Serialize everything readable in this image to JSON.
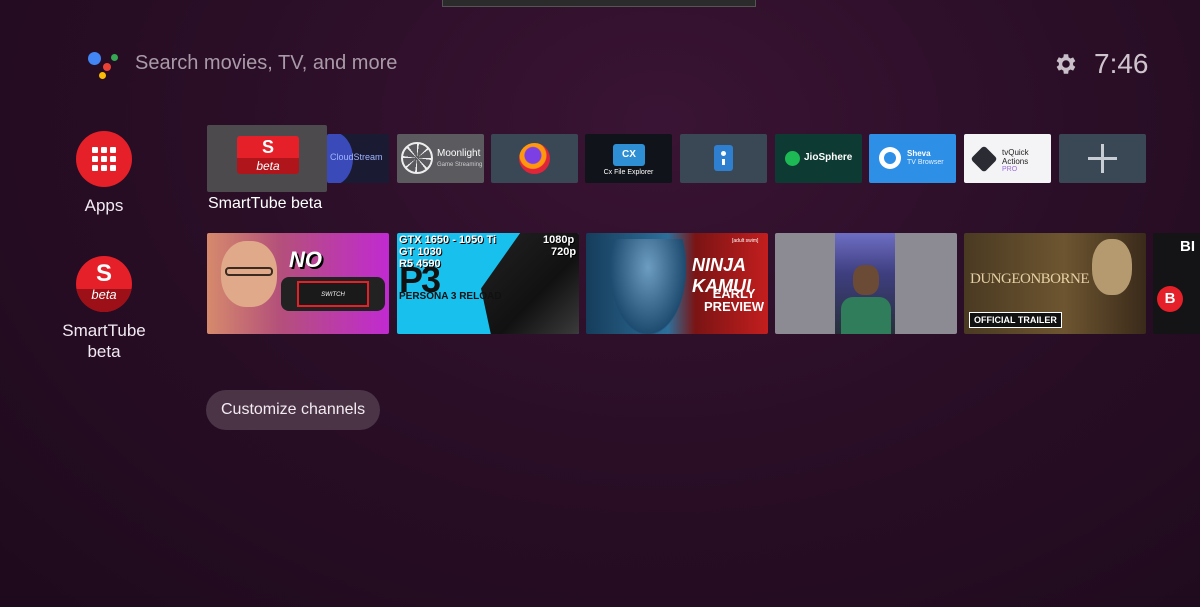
{
  "header": {
    "search_placeholder": "Search movies, TV, and more",
    "clock": "7:46",
    "icons": [
      "google-assistant-icon",
      "gear-icon"
    ]
  },
  "sidebar": {
    "apps_label": "Apps",
    "smarttube_label": "SmartTube beta",
    "smarttube_logo_letter": "S",
    "smarttube_logo_sub": "beta"
  },
  "apps_row": {
    "focused_label": "SmartTube beta",
    "items": [
      {
        "name": "SmartTube beta",
        "logo_letter": "S",
        "logo_sub": "beta"
      },
      {
        "name": "CloudStream",
        "logo_text": "CloudStream"
      },
      {
        "name": "Moonlight",
        "logo_text": "Moonlight",
        "logo_sub": "Game Streaming"
      },
      {
        "name": "Firefox"
      },
      {
        "name": "Cx File Explorer",
        "logo_text": "CX",
        "logo_sub": "Cx File Explorer"
      },
      {
        "name": "Remote"
      },
      {
        "name": "JioSphere",
        "logo_text": "JioSphere"
      },
      {
        "name": "Sheva TV Browser",
        "logo_text": "Sheva",
        "logo_sub": "TV Browser"
      },
      {
        "name": "tvQuick Actions PRO",
        "logo_text": "tvQuick",
        "logo_sub": "Actions",
        "logo_tag": "PRO"
      },
      {
        "name": "Add app",
        "icon": "plus-icon"
      }
    ]
  },
  "video_row": {
    "videos": [
      {
        "overlay": "NO DOCK!",
        "sub": "SWITCH"
      },
      {
        "hud": [
          "GTX 1650 - 1050 Ti",
          "GT 1030",
          "R5 4590",
          "1080p",
          "720p"
        ],
        "title": "P3",
        "sub": "PERSONA 3 RELOAD"
      },
      {
        "title": "NINJA KAMUI",
        "sub": "EARLY PREVIEW",
        "tag": "[adult swim]"
      },
      {
        "overlay": ""
      },
      {
        "title": "DUNGEONBORNE",
        "badge": "OFFICIAL TRAILER"
      },
      {
        "title": "BI",
        "badge": "B"
      }
    ]
  },
  "customize_label": "Customize channels",
  "colors": {
    "accent_red": "#e52028",
    "background": "#2a0e27"
  }
}
